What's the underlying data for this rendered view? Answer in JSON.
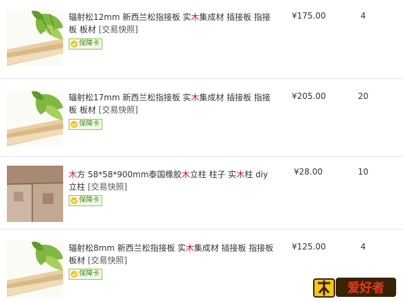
{
  "items": [
    {
      "title_a": "辐射松12mm 新西兰松指接板 实",
      "title_hl": "木",
      "title_b": "集成材 插接板 指接板 板材",
      "snapshot": "[交易快照]",
      "badge": "保障卡",
      "price": "¥175.00",
      "qty": "4",
      "image_icon": "pine-board-with-leaves"
    },
    {
      "title_a": "辐射松17mm 新西兰松指接板 实",
      "title_hl": "木",
      "title_b": "集成材 插接板 指接板 板材",
      "snapshot": "[交易快照]",
      "badge": "保障卡",
      "price": "¥205.00",
      "qty": "20",
      "image_icon": "pine-board-with-leaves"
    },
    {
      "title_hl0": "木",
      "title_a": "方 58*58*900mm泰国橡胶",
      "title_hl": "木",
      "title_b": "立柱 柱子 实",
      "title_hl2": "木",
      "title_c": "柱 diy 立柱",
      "snapshot": "[交易快照]",
      "badge": "保障卡",
      "price": "¥28.00",
      "qty": "10",
      "image_icon": "rubberwood-posts"
    },
    {
      "title_a": "辐射松8mm 新西兰松指接板 实",
      "title_hl": "木",
      "title_b": "集成材 插接板 指接板 板材",
      "snapshot": "[交易快照]",
      "badge": "保障卡",
      "price": "¥125.00",
      "qty": "4",
      "image_icon": "pine-board-with-leaves"
    }
  ],
  "colors": {
    "highlight": "#c8161e",
    "badge_border": "#8fc24a",
    "badge_text": "#3b8a1f",
    "divider": "#e6e6e6"
  },
  "watermark": {
    "text": "木工爱好者",
    "icon": "woodworking-lover-logo"
  }
}
